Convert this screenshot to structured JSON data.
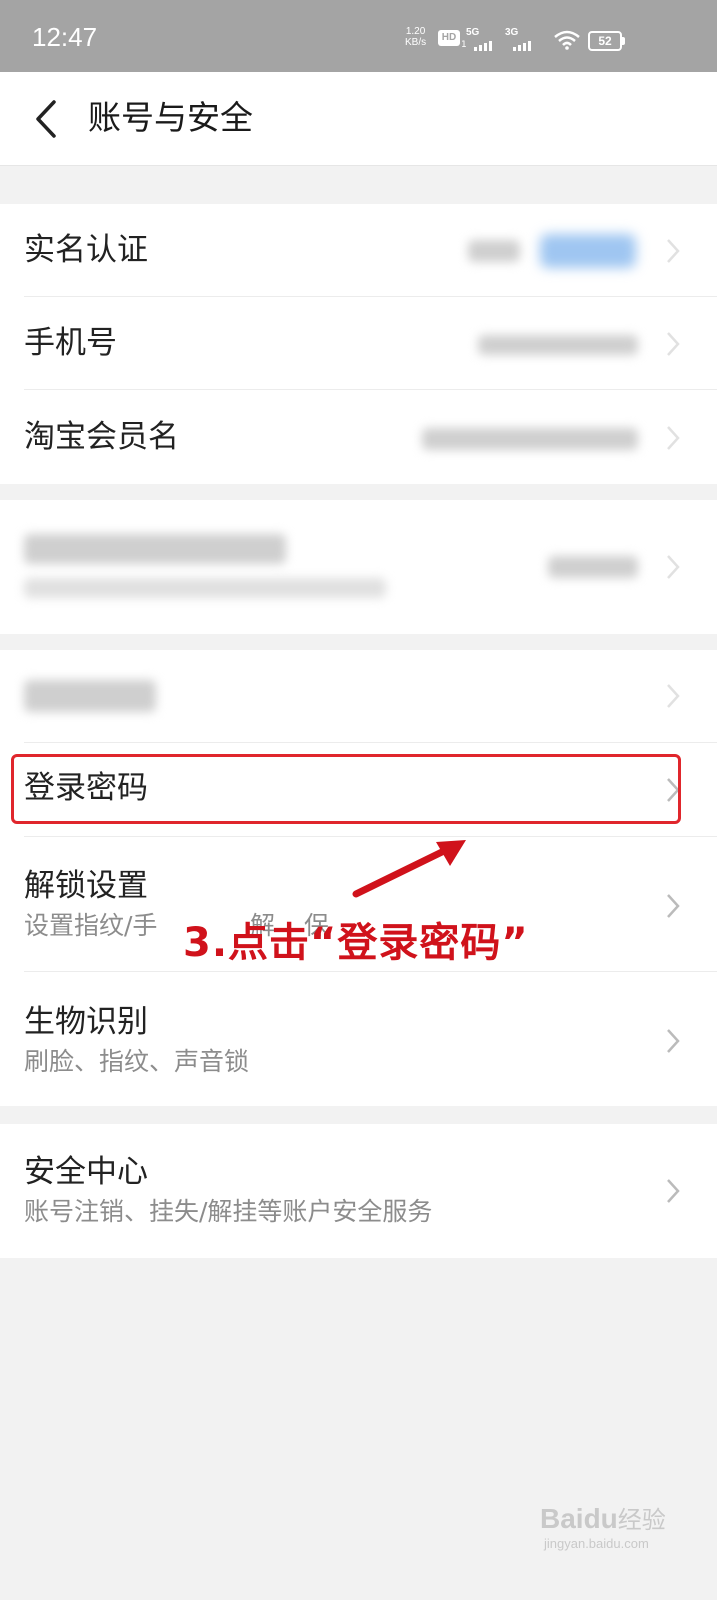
{
  "status_bar": {
    "time": "12:47",
    "net_speed_value": "1.20",
    "net_speed_unit": "KB/s",
    "hd_label": "HD",
    "sim1_label": "1",
    "signal1": "5G",
    "signal2": "3G",
    "battery": "52"
  },
  "header": {
    "title": "账号与安全",
    "back_icon": "chevron-left-icon"
  },
  "groups": {
    "identity": {
      "real_name": "实名认证",
      "phone": "手机号",
      "taobao_member": "淘宝会员名"
    },
    "security": {
      "login_password": "登录密码",
      "unlock_settings": "解锁设置",
      "unlock_settings_sub_left": "设置指纹/手",
      "unlock_settings_sub_mid1": "解",
      "unlock_settings_sub_mid2": "保",
      "biometrics": "生物识别",
      "biometrics_sub": "刷脸、指纹、声音锁"
    },
    "center": {
      "security_center": "安全中心",
      "security_center_sub": "账号注销、挂失/解挂等账户安全服务"
    }
  },
  "annotation": {
    "text": "3.点击“登录密码”",
    "color": "#d0121b"
  },
  "watermark": {
    "brand": "Bai",
    "brand2": "du",
    "cn": "经验",
    "url": "jingyan.baidu.com"
  },
  "colors": {
    "highlight": "#e0262c",
    "status_bar_bg": "#a4a4a4",
    "page_bg": "#f2f2f2"
  }
}
